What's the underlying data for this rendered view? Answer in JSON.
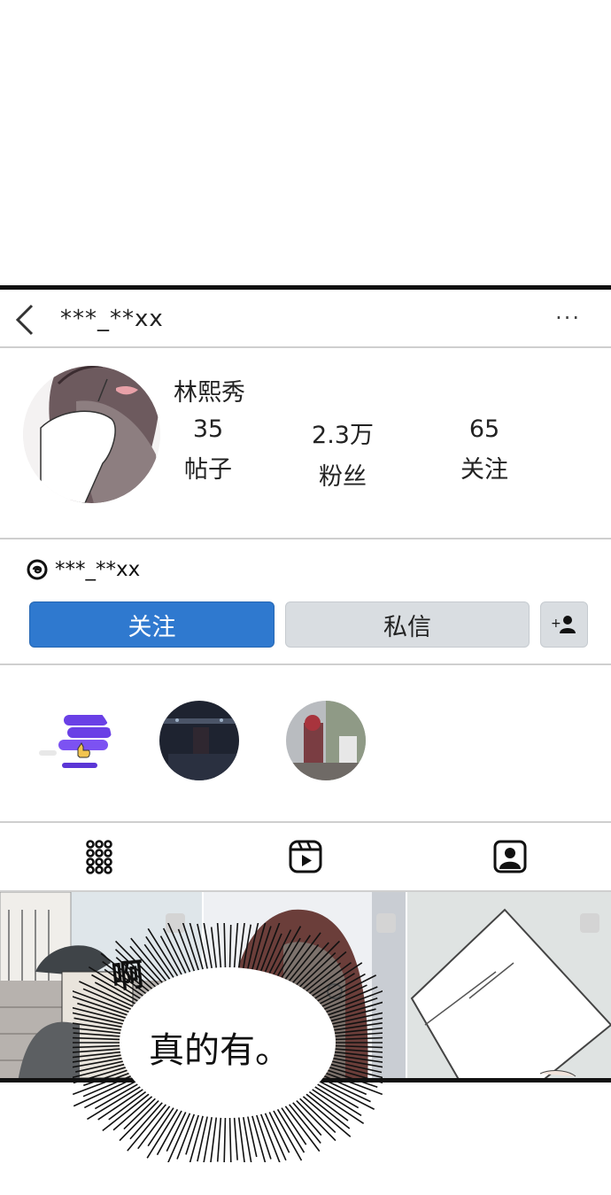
{
  "header": {
    "username": "***_**xx",
    "more_label": "···"
  },
  "profile": {
    "display_name": "林熙秀",
    "stats": [
      {
        "value": "35",
        "label": "帖子"
      },
      {
        "value": "2.3万",
        "label": "粉丝"
      },
      {
        "value": "65",
        "label": "关注"
      }
    ],
    "threads_handle": "***_**xx"
  },
  "actions": {
    "follow_label": "关注",
    "message_label": "私信"
  },
  "highlights": [
    {
      "icon": "thumbs-up-logo-icon"
    },
    {
      "icon": "night-scene-thumbnail"
    },
    {
      "icon": "street-scene-thumbnail"
    }
  ],
  "tabs": [
    {
      "icon": "grid-icon"
    },
    {
      "icon": "reels-icon"
    },
    {
      "icon": "tagged-icon"
    }
  ],
  "comic": {
    "sfx": "啊",
    "speech": "真的有。"
  },
  "colors": {
    "follow_button": "#2f79cf",
    "secondary_button": "#d9dde1",
    "divider": "#cfcfcf",
    "frame_border": "#111111"
  }
}
